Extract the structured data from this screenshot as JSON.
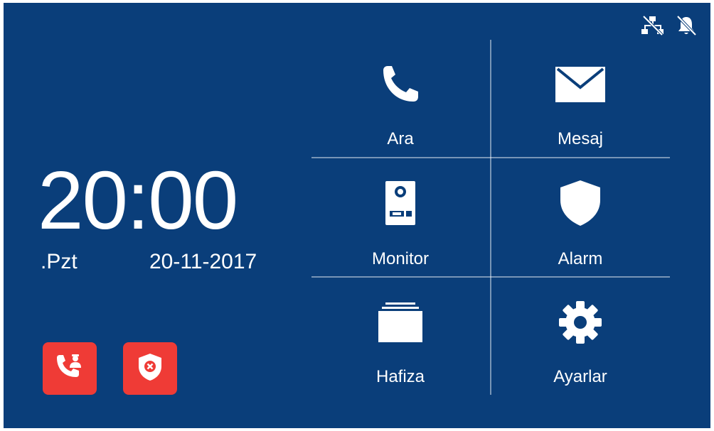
{
  "clock": {
    "time": "20:00",
    "day": ".Pzt",
    "date": "20-11-2017"
  },
  "status_icons": [
    "network-disconnected-icon",
    "bell-muted-icon"
  ],
  "quick_actions": [
    {
      "icon": "call-guard-icon"
    },
    {
      "icon": "alarm-off-shield-icon"
    }
  ],
  "menu": {
    "items": [
      {
        "label": "Ara",
        "icon": "phone-icon"
      },
      {
        "label": "Mesaj",
        "icon": "envelope-icon"
      },
      {
        "label": "Monitor",
        "icon": "door-station-icon"
      },
      {
        "label": "Alarm",
        "icon": "shield-icon"
      },
      {
        "label": "Hafiza",
        "icon": "folder-stack-icon"
      },
      {
        "label": "Ayarlar",
        "icon": "gear-icon"
      }
    ]
  },
  "colors": {
    "background": "#0a3e7a",
    "accent_red": "#ef3b36",
    "text": "#ffffff"
  }
}
